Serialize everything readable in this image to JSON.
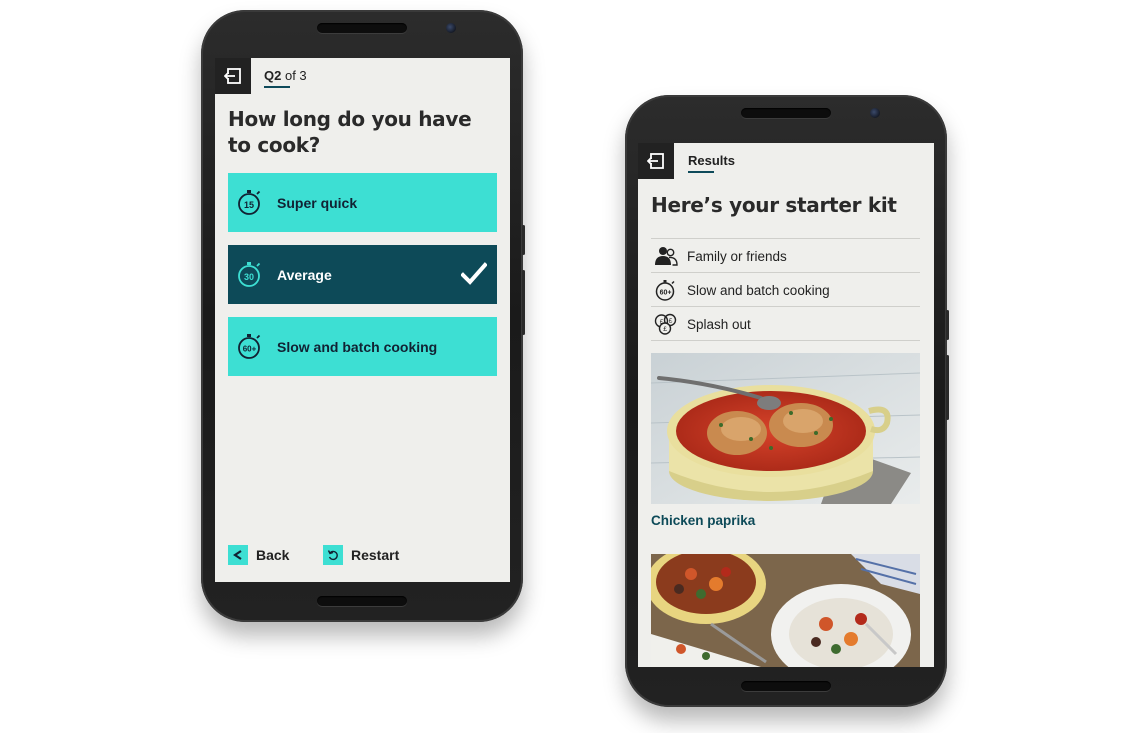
{
  "left_phone": {
    "progress": {
      "current": "Q2",
      "suffix": "of 3"
    },
    "question": "How long do you have to cook?",
    "options": [
      {
        "label": "Super quick",
        "icon": "timer-15-icon",
        "icon_text": "15",
        "selected": false
      },
      {
        "label": "Average",
        "icon": "timer-30-icon",
        "icon_text": "30",
        "selected": true
      },
      {
        "label": "Slow and batch cooking",
        "icon": "timer-60-icon",
        "icon_text": "60+",
        "selected": false
      }
    ],
    "footer": {
      "back_label": "Back",
      "restart_label": "Restart"
    }
  },
  "right_phone": {
    "tab_label": "Results",
    "heading": "Here’s your starter kit",
    "kit_items": [
      {
        "label": "Family or friends",
        "icon": "people-icon"
      },
      {
        "label": "Slow and batch cooking",
        "icon": "timer-60-icon",
        "icon_text": "60+"
      },
      {
        "label": "Splash out",
        "icon": "coins-icon"
      }
    ],
    "recipes": [
      {
        "title": "Chicken paprika",
        "image": "chicken-paprika-photo"
      },
      {
        "title": "",
        "image": "roasted-vegetables-photo"
      }
    ]
  },
  "colors": {
    "accent": "#3ddfd3",
    "selected": "#0d4a58",
    "screen_bg": "#efefec",
    "text_dark": "#222222"
  }
}
